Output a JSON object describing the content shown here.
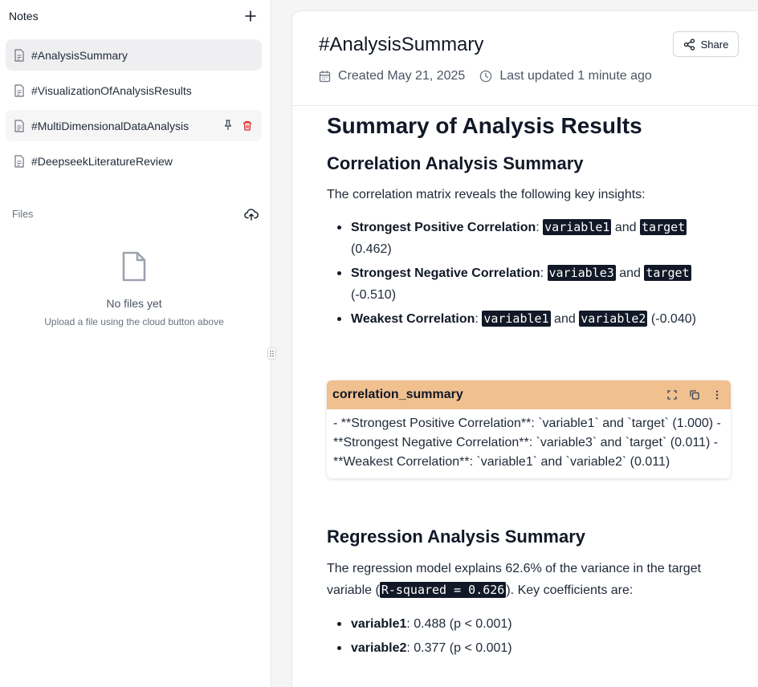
{
  "sidebar": {
    "title": "Notes",
    "notes": [
      {
        "label": "#AnalysisSummary"
      },
      {
        "label": "#VisualizationOfAnalysisResults"
      },
      {
        "label": "#MultiDimensionalDataAnalysis"
      },
      {
        "label": "#DeepseekLiteratureReview"
      }
    ],
    "files_label": "Files",
    "empty_title": "No files yet",
    "empty_subtitle": "Upload a file using the cloud button above"
  },
  "header": {
    "title": "#AnalysisSummary",
    "created": "Created May 21, 2025",
    "updated": "Last updated 1 minute ago",
    "share_label": "Share"
  },
  "doc": {
    "h1": "Summary of Analysis Results",
    "corr_heading": "Correlation Analysis Summary",
    "corr_intro": "The correlation matrix reveals the following key insights:",
    "corr_items": [
      {
        "bold": "Strongest Positive Correlation",
        "sep": ": ",
        "a": "variable1",
        "and": " and ",
        "b": "target",
        "value": " (0.462)"
      },
      {
        "bold": "Strongest Negative Correlation",
        "sep": ": ",
        "a": "variable3",
        "and": " and ",
        "b": "target",
        "value": " (-0.510)"
      },
      {
        "bold": "Weakest Correlation",
        "sep": ": ",
        "a": "variable1",
        "and": " and ",
        "b": "variable2",
        "value": " (-0.040)"
      }
    ],
    "widget": {
      "title": "correlation_summary",
      "body": "- **Strongest Positive Correlation**: `variable1` and `target` (1.000) - **Strongest Negative Correlation**: `variable3` and `target` (0.011) - **Weakest Correlation**: `variable1` and `variable2` (0.011)"
    },
    "reg_heading": "Regression Analysis Summary",
    "reg_text_1": "The regression model explains 62.6% of the variance in the target variable (",
    "reg_code": "R-squared = 0.626",
    "reg_text_2": "). Key coefficients are:",
    "reg_items": [
      {
        "bold": "variable1",
        "rest": ": 0.488 (p < 0.001)"
      },
      {
        "bold": "variable2",
        "rest": ": 0.377 (p < 0.001)"
      }
    ]
  },
  "colors": {
    "widget_header": "#f0c08f",
    "delete_icon": "#dc2626",
    "code_bg": "#111827"
  }
}
